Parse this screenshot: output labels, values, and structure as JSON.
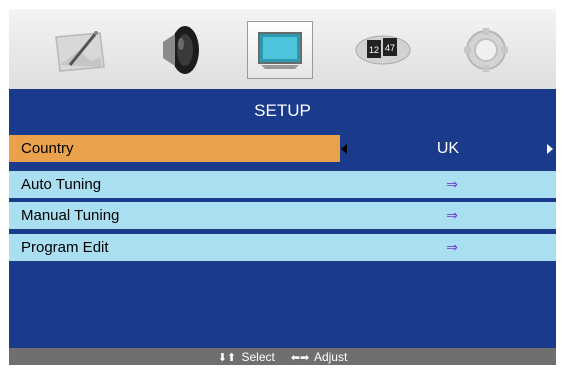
{
  "menu_tabs": [
    {
      "icon": "picture-icon"
    },
    {
      "icon": "speaker-icon"
    },
    {
      "icon": "tv-screen-icon",
      "selected": true
    },
    {
      "icon": "clock-icon"
    },
    {
      "icon": "gear-icon"
    }
  ],
  "setup": {
    "title": "SETUP",
    "items": [
      {
        "label": "Country",
        "value": "UK"
      },
      {
        "label": "Auto Tuning",
        "arrow": "⇒"
      },
      {
        "label": "Manual Tuning",
        "arrow": "⇒"
      },
      {
        "label": "Program Edit",
        "arrow": "⇒"
      }
    ]
  },
  "footer": {
    "select_glyph": "⬇⬆",
    "select_label": "Select",
    "adjust_glyph": "⬅➡",
    "adjust_label": "Adjust"
  },
  "colors": {
    "menu_background": "#1a3a8c",
    "row_background": "#a9dff0",
    "highlight_row": "#e9a24b",
    "footer_background": "#6f6f6f"
  }
}
